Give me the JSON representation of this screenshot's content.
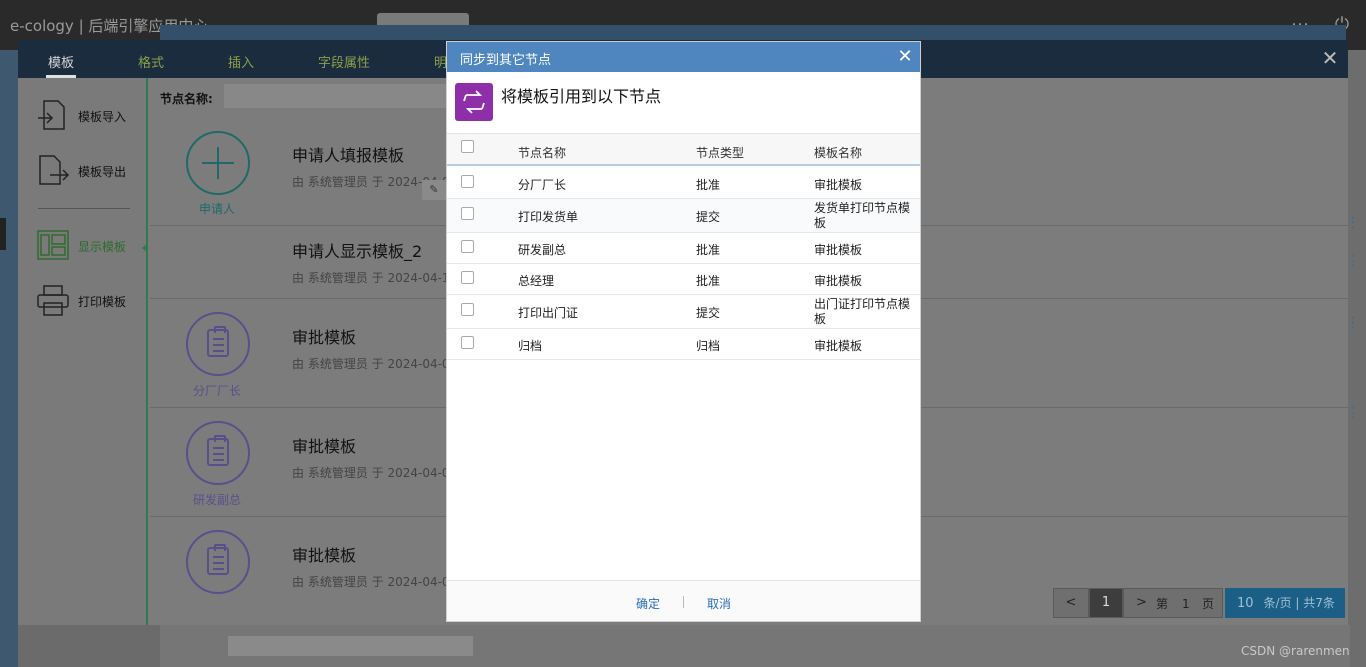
{
  "app": {
    "title": "e-cology | 后端引擎应用中心"
  },
  "editor": {
    "tabs": [
      "模板",
      "格式",
      "插入",
      "字段属性",
      "明"
    ],
    "close_glyph": "✕",
    "side_items": [
      {
        "label": "模板导入",
        "icon": "import-icon"
      },
      {
        "label": "模板导出",
        "icon": "export-icon"
      },
      {
        "label": "显示模板",
        "icon": "layout-icon"
      },
      {
        "label": "打印模板",
        "icon": "printer-icon"
      }
    ],
    "node_name_label": "节点名称:",
    "nodes": [
      {
        "caption": "申请人",
        "title": "申请人填报模板",
        "meta": "由 系统管理员 于 2024-04-0",
        "icon": "plus-icon"
      },
      {
        "caption": "",
        "title": "申请人显示模板_2",
        "meta": "由 系统管理员 于 2024-04-1",
        "icon": ""
      },
      {
        "caption": "分厂厂长",
        "title": "审批模板",
        "meta": "由 系统管理员 于 2024-04-0",
        "icon": "clipboard-icon"
      },
      {
        "caption": "研发副总",
        "title": "审批模板",
        "meta": "由 系统管理员 于 2024-04-0",
        "icon": "clipboard-icon"
      },
      {
        "caption": "",
        "title": "审批模板",
        "meta": "由 系统管理员 于 2024-04-0",
        "icon": "clipboard-icon"
      }
    ],
    "pager": {
      "prev": "<",
      "current": "1",
      "next": ">",
      "page_prefix": "第",
      "page_value": "1",
      "page_suffix": "页",
      "page_size": "10",
      "size_suffix": "条/页 | 共7条"
    }
  },
  "modal": {
    "title": "同步到其它节点",
    "close_glyph": "✕",
    "heading": "将模板引用到以下节点",
    "columns": [
      "节点名称",
      "节点类型",
      "模板名称"
    ],
    "rows": [
      {
        "name": "分厂厂长",
        "type": "批准",
        "template": "审批模板"
      },
      {
        "name": "打印发货单",
        "type": "提交",
        "template": "发货单打印节点模板"
      },
      {
        "name": "研发副总",
        "type": "批准",
        "template": "审批模板"
      },
      {
        "name": "总经理",
        "type": "批准",
        "template": "审批模板"
      },
      {
        "name": "打印出门证",
        "type": "提交",
        "template": "出门证打印节点模板"
      },
      {
        "name": "归档",
        "type": "归档",
        "template": "审批模板"
      }
    ],
    "confirm": "确定",
    "cancel": "取消"
  },
  "watermark": "CSDN @rarenmen",
  "colors": {
    "modal_header": "#4f86bf",
    "modal_icon": "#8e2fa9",
    "link": "#2a6fb8"
  }
}
